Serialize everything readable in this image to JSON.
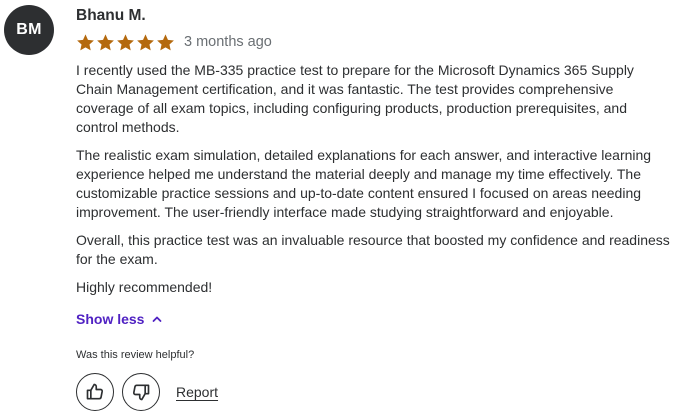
{
  "reviewer": {
    "initials": "BM",
    "name": "Bhanu M."
  },
  "rating": {
    "value": 5,
    "max": 5,
    "star_color": "#b4690e",
    "icon": "star-icon"
  },
  "date": "3 months ago",
  "review": {
    "paragraphs": [
      "I recently used the MB-335 practice test to prepare for the Microsoft Dynamics 365 Supply Chain Management certification, and it was fantastic. The test provides comprehensive coverage of all exam topics, including configuring products, production prerequisites, and control methods.",
      "The realistic exam simulation, detailed explanations for each answer, and interactive learning experience helped me understand the material deeply and manage my time effectively. The customizable practice sessions and up-to-date content ensured I focused on areas needing improvement. The user-friendly interface made studying straightforward and enjoyable.",
      "Overall, this practice test was an invaluable resource that boosted my confidence and readiness for the exam.",
      "Highly recommended!"
    ]
  },
  "show_less": {
    "label": "Show less",
    "icon": "chevron-up-icon",
    "color": "#5022c3"
  },
  "helpful": {
    "question": "Was this review helpful?",
    "like_icon": "thumbs-up-icon",
    "dislike_icon": "thumbs-down-icon",
    "report_label": "Report"
  }
}
